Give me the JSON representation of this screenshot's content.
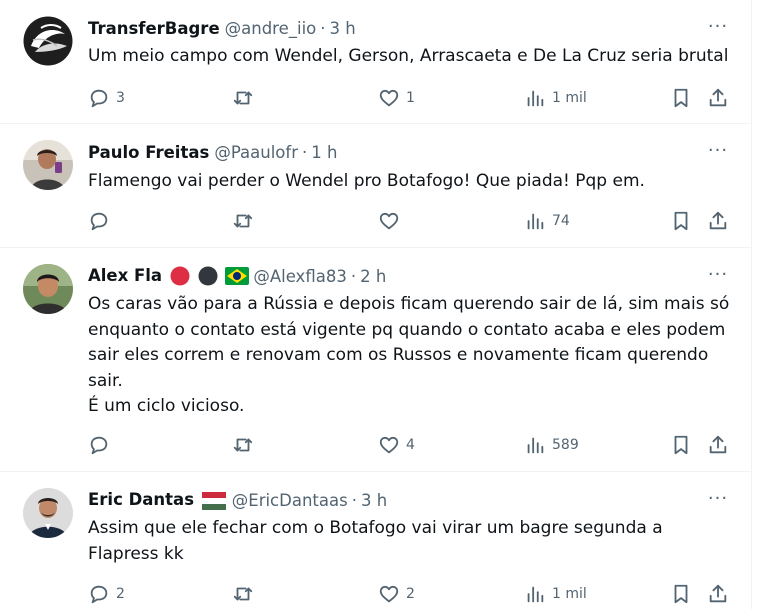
{
  "tweets": [
    {
      "name": "TransferBagre",
      "handle": "@andre_iio",
      "time": "3 h",
      "text": [
        "Um meio campo com Wendel, Gerson, Arrascaeta e De La Cruz seria brutal"
      ],
      "replies": "3",
      "retweets": "",
      "likes": "1",
      "views": "1 mil"
    },
    {
      "name": "Paulo Freitas",
      "handle": "@Paaulofr",
      "time": "1 h",
      "text": [
        "Flamengo vai perder o Wendel pro Botafogo! Que piada! Pqp em."
      ],
      "replies": "",
      "retweets": "",
      "likes": "",
      "views": "74"
    },
    {
      "name": "Alex Fla",
      "handle": "@Alexfla83",
      "time": "2 h",
      "text": [
        "Os caras vão para a Rússia e depois ficam querendo sair de lá, sim mais só",
        "enquanto o contato está vigente pq quando o contato acaba e eles podem",
        "sair eles correm e renovam com os Russos e novamente ficam querendo",
        "sair.",
        "É um ciclo vicioso."
      ],
      "replies": "",
      "retweets": "",
      "likes": "4",
      "views": "589"
    },
    {
      "name": "Eric Dantas",
      "handle": "@EricDantaas",
      "time": "3 h",
      "text": [
        "Assim que ele fechar com o Botafogo vai virar um bagre segunda a",
        "Flapress kk"
      ],
      "replies": "2",
      "retweets": "",
      "likes": "2",
      "views": "1 mil"
    }
  ],
  "more_glyph": "···",
  "separator": "·",
  "colors": {
    "text": "#0f1419",
    "secondary": "#536471",
    "border": "#eff3f4"
  },
  "icons": [
    "reply-icon",
    "retweet-icon",
    "like-icon",
    "views-icon",
    "bookmark-icon",
    "share-icon",
    "more-icon"
  ]
}
